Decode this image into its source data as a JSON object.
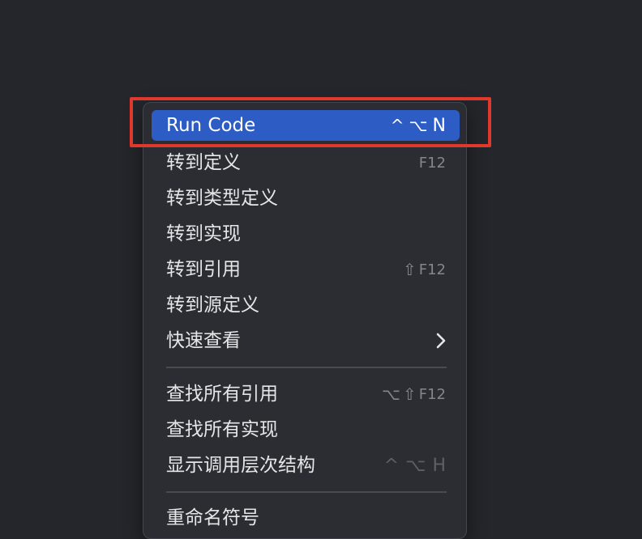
{
  "menu": {
    "items": [
      {
        "label": "Run Code",
        "shortcut": [
          "^",
          "⌥",
          "N"
        ]
      },
      {
        "label": "转到定义",
        "shortcut": [
          "F12"
        ]
      },
      {
        "label": "转到类型定义"
      },
      {
        "label": "转到实现"
      },
      {
        "label": "转到引用",
        "shortcut": [
          "⇧",
          "F12"
        ]
      },
      {
        "label": "转到源定义"
      },
      {
        "label": "快速查看",
        "submenu_icon": "chevron-right-icon"
      },
      {
        "label": "查找所有引用",
        "shortcut": [
          "⌥",
          "⇧",
          "F12"
        ]
      },
      {
        "label": "查找所有实现"
      },
      {
        "label": "显示调用层次结构",
        "shortcut": [
          "^",
          "⌥",
          "H"
        ]
      },
      {
        "label": "重命名符号"
      }
    ]
  },
  "colors": {
    "background": "#25262b",
    "menu_background": "#2c2d33",
    "highlight": "#2d5cc4",
    "callout_border": "#e0382d"
  }
}
